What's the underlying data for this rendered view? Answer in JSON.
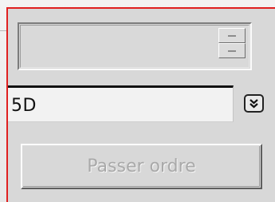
{
  "spinner": {
    "value": "",
    "up_icon": "spin-up-icon",
    "down_icon": "spin-down-icon"
  },
  "combo": {
    "value": "5D",
    "dropdown_icon": "double-chevron-down-icon"
  },
  "submit_button": {
    "label": "Passer ordre",
    "state": "disabled"
  },
  "colors": {
    "frame_border": "#e02020",
    "panel_bg": "#d8d8d8",
    "disabled_text": "#a9a9a9"
  }
}
